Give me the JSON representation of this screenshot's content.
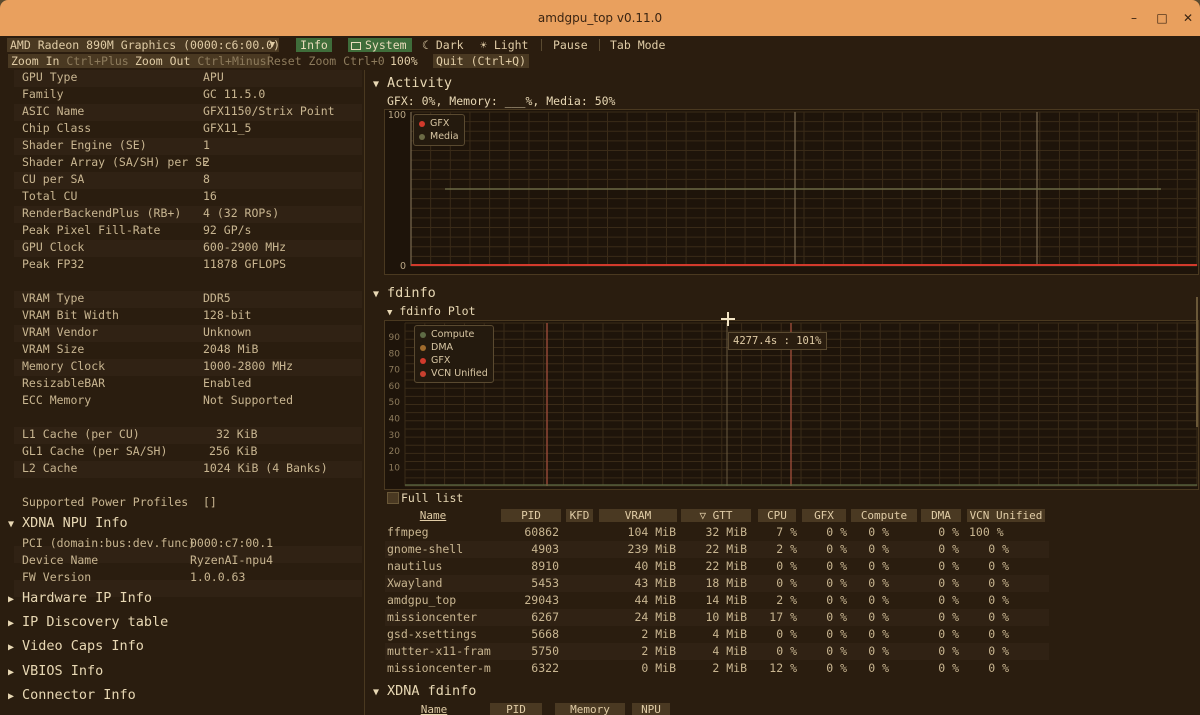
{
  "window": {
    "title": "amdgpu_top v0.11.0"
  },
  "toolbar": {
    "device": "AMD Radeon 890M Graphics (0000:c6:00.0)",
    "info": "Info",
    "system": "System",
    "dark": "☾ Dark",
    "light": "☀ Light",
    "pause": "Pause",
    "tab_mode": "Tab Mode",
    "zoom_in": "Zoom In",
    "zoom_in_shortcut": "Ctrl+Plus",
    "zoom_out": "Zoom Out",
    "zoom_out_shortcut": "Ctrl+Minus",
    "reset_zoom": "Reset Zoom Ctrl+0",
    "zoom_level": "100%",
    "quit": "Quit (Ctrl+Q)"
  },
  "gpu_info": {
    "group1": [
      {
        "k": "GPU Type",
        "v": "APU"
      },
      {
        "k": "Family",
        "v": "GC 11.5.0"
      },
      {
        "k": "ASIC Name",
        "v": "GFX1150/Strix Point"
      },
      {
        "k": "Chip Class",
        "v": "GFX11_5"
      },
      {
        "k": "Shader Engine (SE)",
        "v": "1"
      },
      {
        "k": "Shader Array (SA/SH) per SE",
        "v": "2"
      },
      {
        "k": "CU per SA",
        "v": "8"
      },
      {
        "k": "Total CU",
        "v": "16"
      },
      {
        "k": "RenderBackendPlus (RB+)",
        "v": "4 (32 ROPs)"
      },
      {
        "k": "Peak Pixel Fill-Rate",
        "v": "92 GP/s"
      },
      {
        "k": "GPU Clock",
        "v": "600-2900 MHz"
      },
      {
        "k": "Peak FP32",
        "v": "11878 GFLOPS"
      }
    ],
    "group2": [
      {
        "k": "VRAM Type",
        "v": "DDR5"
      },
      {
        "k": "VRAM Bit Width",
        "v": "128-bit"
      },
      {
        "k": "VRAM Vendor",
        "v": "Unknown"
      },
      {
        "k": "VRAM Size",
        "v": "2048 MiB"
      },
      {
        "k": "Memory Clock",
        "v": "1000-2800 MHz"
      },
      {
        "k": "ResizableBAR",
        "v": "Enabled"
      },
      {
        "k": "ECC Memory",
        "v": "Not Supported"
      }
    ],
    "group3": [
      {
        "k": "L1 Cache (per CU)",
        "v": "32 KiB"
      },
      {
        "k": "GL1 Cache (per SA/SH)",
        "v": "256 KiB"
      },
      {
        "k": "L2 Cache",
        "v": "1024 KiB (4 Banks)"
      }
    ],
    "power_profiles": {
      "k": "Supported Power Profiles",
      "v": "[]"
    }
  },
  "xdna_npu": {
    "title": "XDNA NPU Info",
    "rows": [
      {
        "k": "PCI (domain:bus:dev.func)",
        "v": "0000:c7:00.1"
      },
      {
        "k": "Device Name",
        "v": "RyzenAI-npu4"
      },
      {
        "k": "FW Version",
        "v": "1.0.0.63"
      }
    ]
  },
  "collapsed_sections": [
    "Hardware IP Info",
    "IP Discovery table",
    "Video Caps Info",
    "VBIOS Info",
    "Connector Info"
  ],
  "activity": {
    "title": "Activity",
    "summary": "GFX:    0%, Memory: ___%, Media:  50%",
    "y_max_label": "100",
    "y_min_label": "0",
    "legend": [
      {
        "name": "GFX",
        "color": "#d23a2c"
      },
      {
        "name": "Media",
        "color": "#6b6a45"
      }
    ],
    "series": {
      "gfx_percent": 0,
      "media_percent": 50
    }
  },
  "fdinfo": {
    "title": "fdinfo",
    "plot_title": "fdinfo Plot",
    "y_ticks": [
      "90",
      "80",
      "70",
      "60",
      "50",
      "40",
      "30",
      "20",
      "10"
    ],
    "legend": [
      {
        "name": "Compute",
        "color": "#5e6b45"
      },
      {
        "name": "DMA",
        "color": "#a06b2c"
      },
      {
        "name": "GFX",
        "color": "#d23a2c"
      },
      {
        "name": "VCN Unified",
        "color": "#c8402f"
      }
    ],
    "tooltip": "4277.4s :  101%",
    "full_list": "Full list",
    "columns": [
      "Name",
      "PID",
      "KFD",
      "VRAM",
      "▽ GTT",
      "CPU",
      "GFX",
      "Compute",
      "DMA",
      "VCN Unified"
    ],
    "rows": [
      {
        "name": "ffmpeg",
        "pid": "60862",
        "vram": "104 MiB",
        "gtt": "32 MiB",
        "cpu": "7 %",
        "gfx": "0 %",
        "compute": "0 %",
        "dma": "0 %",
        "vcn": "100 %"
      },
      {
        "name": "gnome-shell",
        "pid": "4903",
        "vram": "239 MiB",
        "gtt": "22 MiB",
        "cpu": "2 %",
        "gfx": "0 %",
        "compute": "0 %",
        "dma": "0 %",
        "vcn": "0 %"
      },
      {
        "name": "nautilus",
        "pid": "8910",
        "vram": "40 MiB",
        "gtt": "22 MiB",
        "cpu": "0 %",
        "gfx": "0 %",
        "compute": "0 %",
        "dma": "0 %",
        "vcn": "0 %"
      },
      {
        "name": "Xwayland",
        "pid": "5453",
        "vram": "43 MiB",
        "gtt": "18 MiB",
        "cpu": "0 %",
        "gfx": "0 %",
        "compute": "0 %",
        "dma": "0 %",
        "vcn": "0 %"
      },
      {
        "name": "amdgpu_top",
        "pid": "29043",
        "vram": "44 MiB",
        "gtt": "14 MiB",
        "cpu": "2 %",
        "gfx": "0 %",
        "compute": "0 %",
        "dma": "0 %",
        "vcn": "0 %"
      },
      {
        "name": "missioncenter",
        "pid": "6267",
        "vram": "24 MiB",
        "gtt": "10 MiB",
        "cpu": "17 %",
        "gfx": "0 %",
        "compute": "0 %",
        "dma": "0 %",
        "vcn": "0 %"
      },
      {
        "name": "gsd-xsettings",
        "pid": "5668",
        "vram": "2 MiB",
        "gtt": "4 MiB",
        "cpu": "0 %",
        "gfx": "0 %",
        "compute": "0 %",
        "dma": "0 %",
        "vcn": "0 %"
      },
      {
        "name": "mutter-x11-fram",
        "pid": "5750",
        "vram": "2 MiB",
        "gtt": "4 MiB",
        "cpu": "0 %",
        "gfx": "0 %",
        "compute": "0 %",
        "dma": "0 %",
        "vcn": "0 %"
      },
      {
        "name": "missioncenter-m",
        "pid": "6322",
        "vram": "0 MiB",
        "gtt": "2 MiB",
        "cpu": "12 %",
        "gfx": "0 %",
        "compute": "0 %",
        "dma": "0 %",
        "vcn": "0 %"
      }
    ]
  },
  "xdna_fdinfo": {
    "title": "XDNA fdinfo",
    "columns": [
      "Name",
      "PID",
      "Memory",
      "NPU"
    ]
  }
}
